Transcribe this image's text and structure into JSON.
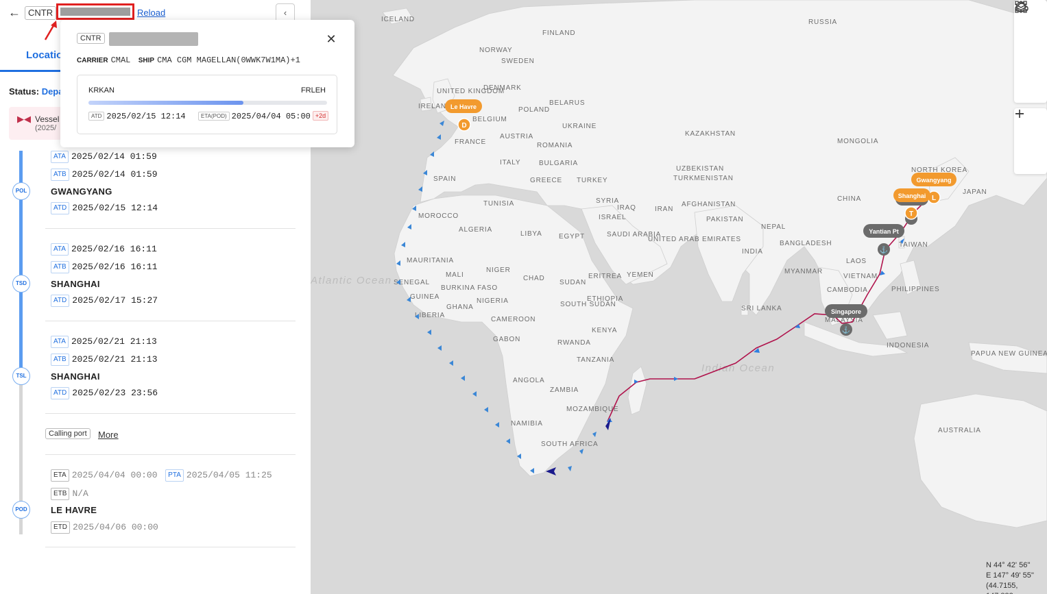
{
  "header": {
    "cntr_tag": "CNTR",
    "reload_label": "Reload",
    "collapse_glyph": "‹"
  },
  "tabs": {
    "location_label": "Locatio"
  },
  "status": {
    "label": "Status:",
    "value": "Depa"
  },
  "vessel_card": {
    "label": "Vessel",
    "date": "(2025/"
  },
  "popup": {
    "cntr_tag": "CNTR",
    "carrier_label": "CARRIER",
    "carrier_value": "CMAL",
    "ship_label": "SHIP",
    "ship_value": "CMA CGM MAGELLAN(0WWK7W1MA)+1",
    "route_from": "KRKAN",
    "route_to": "FRLEH",
    "progress_fraction": 0.65,
    "atd_code": "ATD",
    "atd_value": "2025/02/15 12:14",
    "eta_code": "ETA(POD)",
    "eta_value": "2025/04/04 05:00",
    "delay_badge": "+2d"
  },
  "timeline": {
    "first_event_top": [
      {
        "code": "ATA",
        "value": "2025/02/14 01:59"
      },
      {
        "code": "ATB",
        "value": "2025/02/14 01:59"
      }
    ],
    "pol": {
      "node": "POL",
      "port": "GWANGYANG",
      "atd_code": "ATD",
      "atd_value": "2025/02/15 12:14"
    },
    "tsd": {
      "node": "TSD",
      "ata_code": "ATA",
      "ata_value": "2025/02/16 16:11",
      "atb_code": "ATB",
      "atb_value": "2025/02/16 16:11",
      "port": "SHANGHAI",
      "atd_code": "ATD",
      "atd_value": "2025/02/17 15:27"
    },
    "tsl": {
      "node": "TSL",
      "ata_code": "ATA",
      "ata_value": "2025/02/21 21:13",
      "atb_code": "ATB",
      "atb_value": "2025/02/21 21:13",
      "port": "SHANGHAI",
      "atd_code": "ATD",
      "atd_value": "2025/02/23 23:56"
    },
    "calling_port_label": "Calling port",
    "more_label": "More",
    "pod": {
      "node": "POD",
      "eta_code": "ETA",
      "eta_value": "2025/04/04 00:00",
      "pta_code": "PTA",
      "pta_value": "2025/04/05 11:25",
      "etb_code": "ETB",
      "etb_value": "N/A",
      "port": "LE HAVRE",
      "etd_code": "ETD",
      "etd_value": "2025/04/06 00:00"
    }
  },
  "map": {
    "country_labels": [
      "ICELAND",
      "FINLAND",
      "NORWAY",
      "SWEDEN",
      "RUSSIA",
      "UNITED KINGDOM",
      "IRELAND",
      "DENMARK",
      "BELARUS",
      "POLAND",
      "BELGIUM",
      "UKRAINE",
      "FRANCE",
      "AUSTRIA",
      "ROMANIA",
      "KAZAKHSTAN",
      "MONGOLIA",
      "ITALY",
      "BULGARIA",
      "UZBEKISTAN",
      "TURKMENISTAN",
      "SPAIN",
      "GREECE",
      "TURKEY",
      "NORTH KOREA",
      "JAPAN",
      "TUNISIA",
      "SYRIA",
      "IRAQ",
      "IRAN",
      "AFGHANISTAN",
      "CHINA",
      "MOROCCO",
      "ISRAEL",
      "PAKISTAN",
      "ALGERIA",
      "LIBYA",
      "EGYPT",
      "SAUDI ARABIA",
      "UNITED ARAB EMIRATES",
      "NEPAL",
      "BANGLADESH",
      "TAIWAN",
      "INDIA",
      "MAURITANIA",
      "MALI",
      "NIGER",
      "CHAD",
      "SUDAN",
      "ERITREA",
      "YEMEN",
      "MYANMAR",
      "LAOS",
      "VIETNAM",
      "PHILIPPINES",
      "SENEGAL",
      "BURKINA FASO",
      "GUINEA",
      "NIGERIA",
      "GHANA",
      "ETHIOPIA",
      "SOUTH SUDAN",
      "CAMBODIA",
      "SRI LANKA",
      "LIBERIA",
      "CAMEROON",
      "MALAYSIA",
      "KENYA",
      "GABON",
      "RWANDA",
      "INDONESIA",
      "PAPUA NEW GUINEA",
      "TANZANIA",
      "ANGOLA",
      "ZAMBIA",
      "MOZAMBIQUE",
      "NAMIBIA",
      "SOUTH AFRICA",
      "AUSTRALIA"
    ],
    "ocean_labels": [
      "Atlantic Ocean",
      "Indian Ocean"
    ],
    "markers": {
      "le_havre": "Le Havre",
      "gwangyang": "Gwangyang",
      "shanghai": "Shanghai",
      "yantian": "Yantian Pt",
      "singapore": "Singapore",
      "letter_d": "D",
      "letter_l": "L",
      "letter_t": "T"
    },
    "colors": {
      "orange": "#f29a2e",
      "gray_marker": "#6b6b6b",
      "route": "#b0134c",
      "arrow": "#2f7fe0"
    },
    "icons": [
      "layers-icon",
      "draw-shape-icon",
      "weather-icon",
      "zoom-in-icon",
      "zoom-out-icon"
    ],
    "coordinates": {
      "lat": "N 44° 42' 56''",
      "lon": "E 147° 49' 55''",
      "decimal": "(44.7155, 147.832"
    }
  }
}
